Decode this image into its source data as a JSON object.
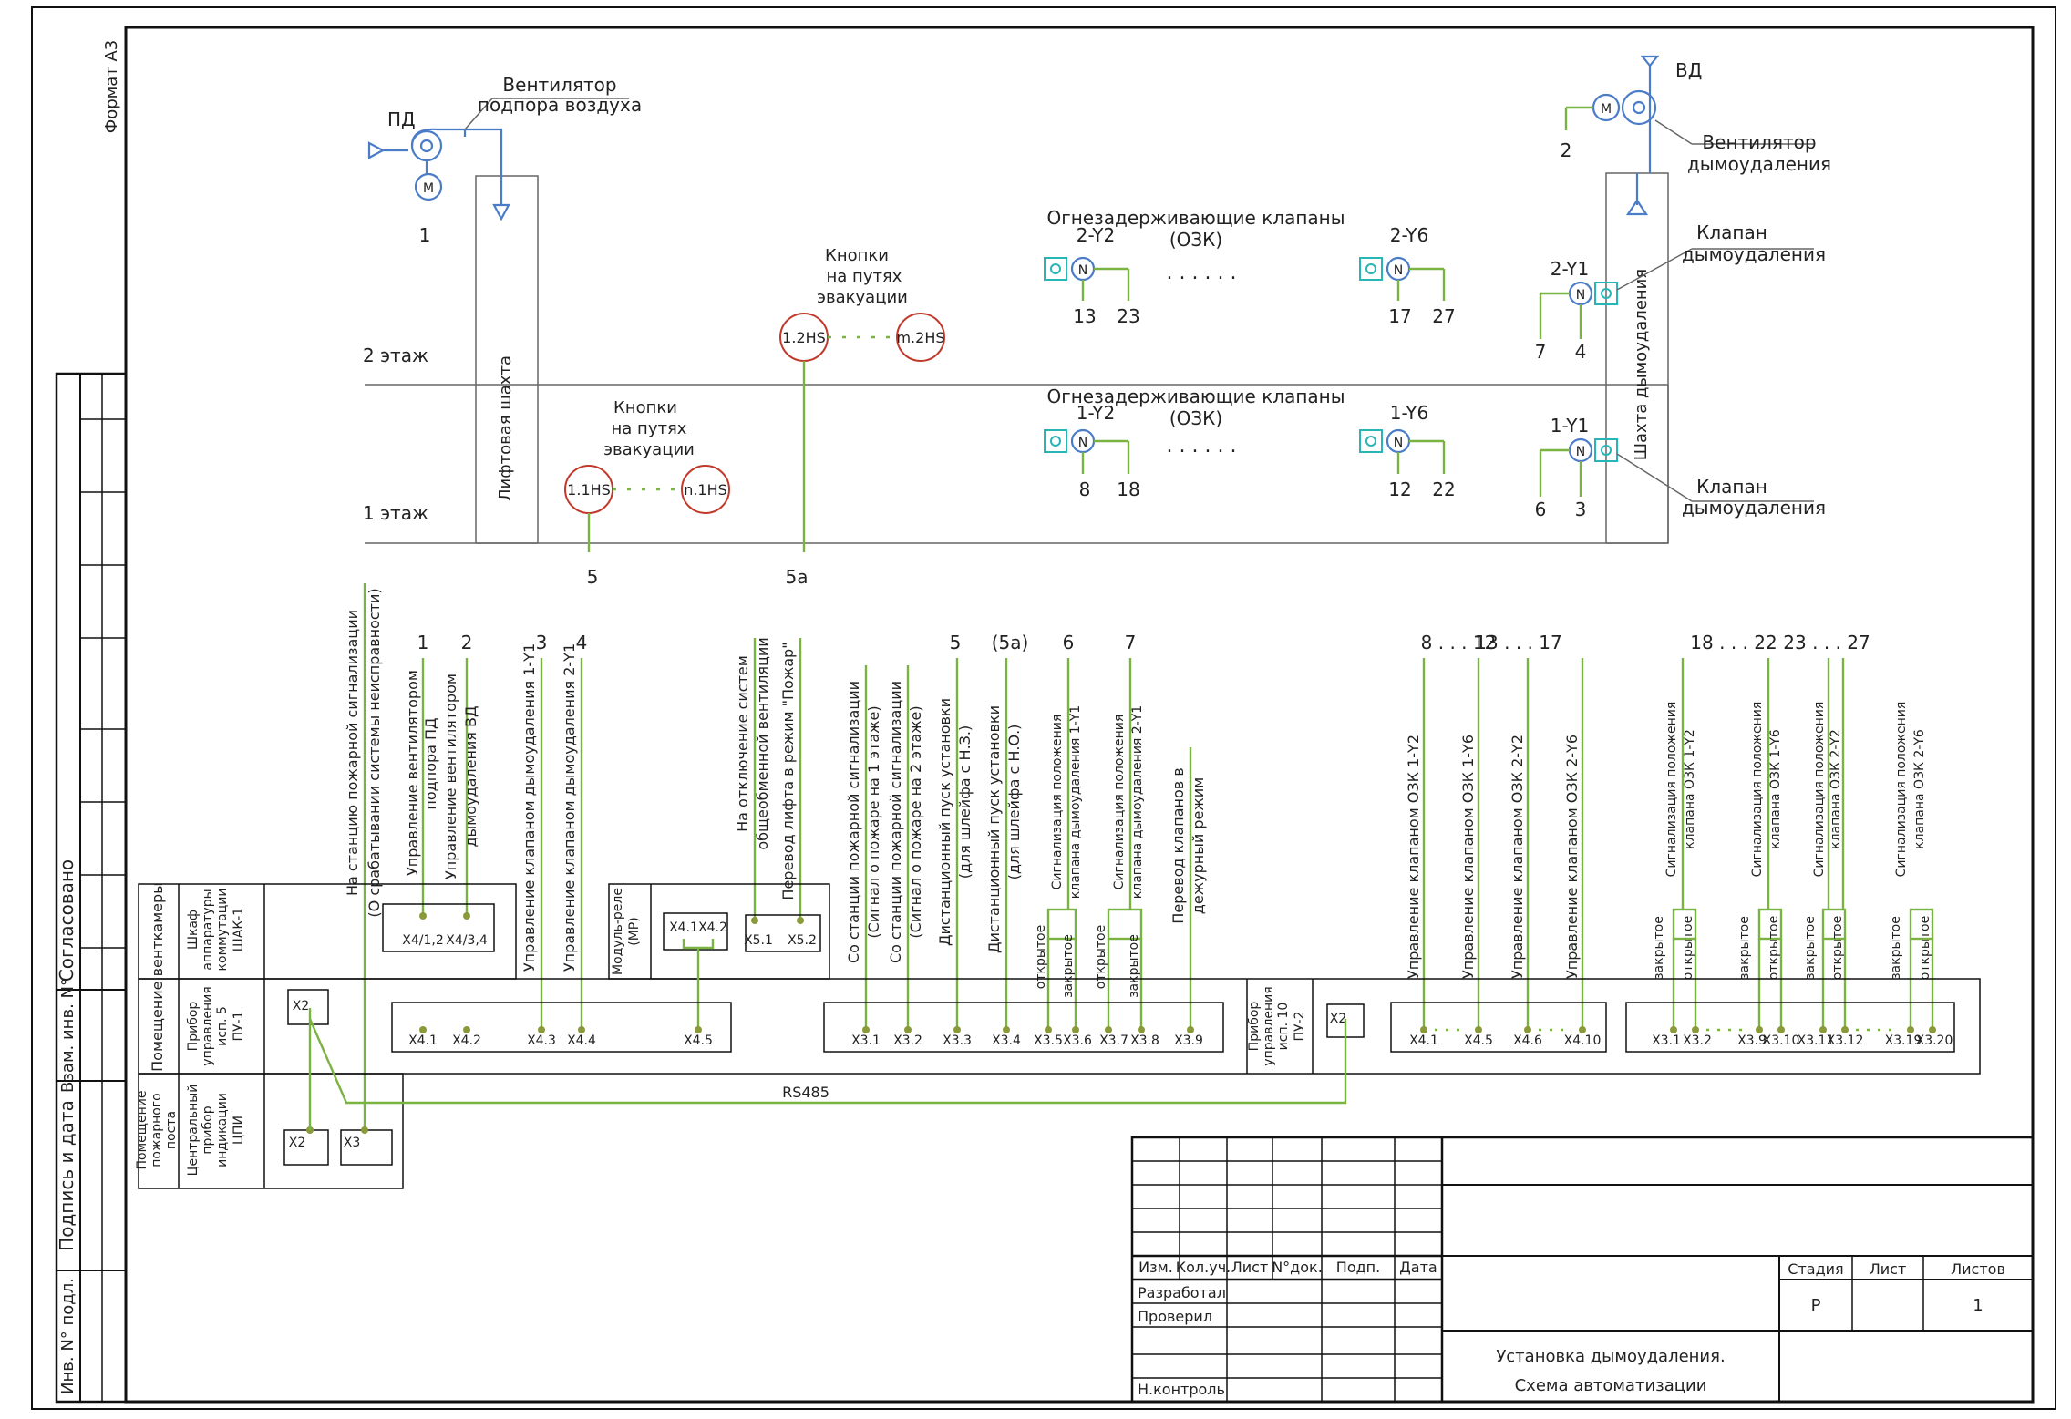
{
  "sheet": {
    "format": "Формат А3",
    "side_labels": [
      "Согласовано",
      "Взам. инв. N°",
      "Подпись и дата",
      "Инв. N° подл."
    ]
  },
  "equipment": {
    "fan_supply_tag": "ПД",
    "fan_supply_label": [
      "Вентилятор",
      "подпора воздуха"
    ],
    "fan_supply_num": "1",
    "fan_exhaust_tag": "ВД",
    "fan_exhaust_label": [
      "Вентилятор",
      "дымоудаления"
    ],
    "fan_exhaust_num": "2",
    "motor": "М",
    "motor_n": "N",
    "lift_shaft": "Лифтовая шахта",
    "smoke_shaft": "Шахта дымоудаления",
    "floor2": "2 этаж",
    "floor1": "1 этаж",
    "valve_smoke_label": [
      "Клапан",
      "дымоудаления"
    ],
    "fire_valves_label": [
      "Огнезадерживающие клапаны",
      "(ОЗК)"
    ],
    "buttons_label": [
      "Кнопки",
      "на путях",
      "эвакуации"
    ],
    "dots": ". . . . . .",
    "floor2_valves": [
      {
        "tag": "2-Y2",
        "a": "13",
        "b": "23"
      },
      {
        "tag": "2-Y6",
        "a": "17",
        "b": "27"
      }
    ],
    "floor1_valves": [
      {
        "tag": "1-Y2",
        "a": "8",
        "b": "18"
      },
      {
        "tag": "1-Y6",
        "a": "12",
        "b": "22"
      }
    ],
    "smoke_valve_2": {
      "tag": "2-Y1",
      "a": "7",
      "b": "4"
    },
    "smoke_valve_1": {
      "tag": "1-Y1",
      "a": "6",
      "b": "3"
    },
    "buttons_floor2": {
      "first": "1.2HS",
      "last": "m.2HS",
      "num": "5а"
    },
    "buttons_floor1": {
      "first": "1.1HS",
      "last": "n.1HS",
      "num": "5"
    }
  },
  "signals": {
    "top_nums": [
      "1",
      "2",
      "3",
      "4",
      "5",
      "(5а)",
      "6",
      "7",
      "8 . . . 12",
      "13 . . . 17",
      "18 . . . 22",
      "23 . . . 27"
    ],
    "fire_station": [
      "На станцию пожарной сигнализации",
      "(О срабатывании системы неисправности)"
    ],
    "fan_pd": [
      "Управление вентилятором",
      "подпора ПД"
    ],
    "fan_vd": [
      "Управление вентилятором",
      "дымоудаления ВД"
    ],
    "valve_1y1": "Управление клапаном дымоудаления 1-Y1",
    "valve_2y1": "Управление клапаном дымоудаления 2-Y1",
    "vent_off": [
      "На отключение систем",
      "общеобменной вентиляции"
    ],
    "lift_fire": "Перевод лифта в режим \"Пожар\"",
    "fire_floor1": [
      "Со станции пожарной сигнализации",
      "(Сигнал о пожаре на 1 этаже)"
    ],
    "fire_floor2": [
      "Со станции пожарной сигнализации",
      "(Сигнал о пожаре на 2 этаже)"
    ],
    "remote_no": [
      "Дистанционный пуск установки",
      "(для шлейфа с Н.З.)"
    ],
    "remote_nc": [
      "Дистанционный пуск установки",
      "(для шлейфа с Н.О.)"
    ],
    "pos_1y1": [
      "Сигнализация положения",
      "клапана дымоудаления 1-Y1"
    ],
    "pos_2y1": [
      "Сигнализация положения",
      "клапана дымоудаления 2-Y1"
    ],
    "standby": [
      "Перевод клапанов в",
      "дежурный режим"
    ],
    "ozk_1y2": "Управление клапаном ОЗК 1-Y2",
    "ozk_1y6": "Управление клапаном ОЗК 1-Y6",
    "ozk_2y2": "Управление клапаном ОЗК 2-Y2",
    "ozk_2y6": "Управление клапаном ОЗК 2-Y6",
    "pos_ozk_1y2": [
      "Сигнализация положения",
      "клапана ОЗК 1-Y2"
    ],
    "pos_ozk_1y6": [
      "Сигнализация положения",
      "клапана ОЗК 1-Y6"
    ],
    "pos_ozk_2y2": [
      "Сигнализация положения",
      "клапана ОЗК 2-Y2"
    ],
    "pos_ozk_2y6": [
      "Сигнализация положения",
      "клапана ОЗК 2-Y6"
    ],
    "open": "открытое",
    "closed": "закрытое"
  },
  "cabinet": {
    "room_vent": "Помещение венткамеры",
    "room_fire": [
      "Помещение",
      "пожарного",
      "поста"
    ],
    "shak": [
      "Шкаф",
      "аппаратуры",
      "коммутации",
      "ШАК-1"
    ],
    "pu1": [
      "Прибор",
      "управления",
      "исп. 5",
      "ПУ-1"
    ],
    "cpi": [
      "Центральный",
      "прибор",
      "индикации",
      "ЦПИ"
    ],
    "mr": [
      "Модуль-реле",
      "(МР)"
    ],
    "pu2": [
      "Прибор",
      "управления",
      "исп. 10",
      "ПУ-2"
    ],
    "x4_12": "X4/1,2",
    "x4_34": "X4/3,4",
    "x41": "X4.1",
    "x42": "X4.2",
    "x51": "X5.1",
    "x52": "X5.2",
    "x2": "X2",
    "x3": "X3",
    "rs485": "RS485",
    "pu1_terms_a": [
      "X4.1",
      "X4.2",
      "X4.3",
      "X4.4",
      "X4.5"
    ],
    "pu1_terms_b": [
      "X3.1",
      "X3.2",
      "X3.3",
      "X3.4",
      "X3.5",
      "X3.6",
      "X3.7",
      "X3.8",
      "X3.9"
    ],
    "pu2_terms_a": [
      "X4.1",
      "X4.5",
      "X4.6",
      "X4.10"
    ],
    "pu2_terms_b": [
      "X3.1",
      "X3.2",
      "X3.9",
      "X3.10",
      "X3.11",
      "X3.12",
      "X3.19",
      "X3.20"
    ]
  },
  "title_block": {
    "headers": [
      "Изм.",
      "Кол.уч.",
      "Лист",
      "N°док.",
      "Подп.",
      "Дата"
    ],
    "roles": [
      "Разработал",
      "Проверил",
      "",
      "",
      "Н.контроль"
    ],
    "stage_h": "Стадия",
    "sheet_h": "Лист",
    "sheets_h": "Листов",
    "stage": "Р",
    "sheets": "1",
    "title1": "Установка дымоудаления.",
    "title2": "Схема автоматизации"
  }
}
